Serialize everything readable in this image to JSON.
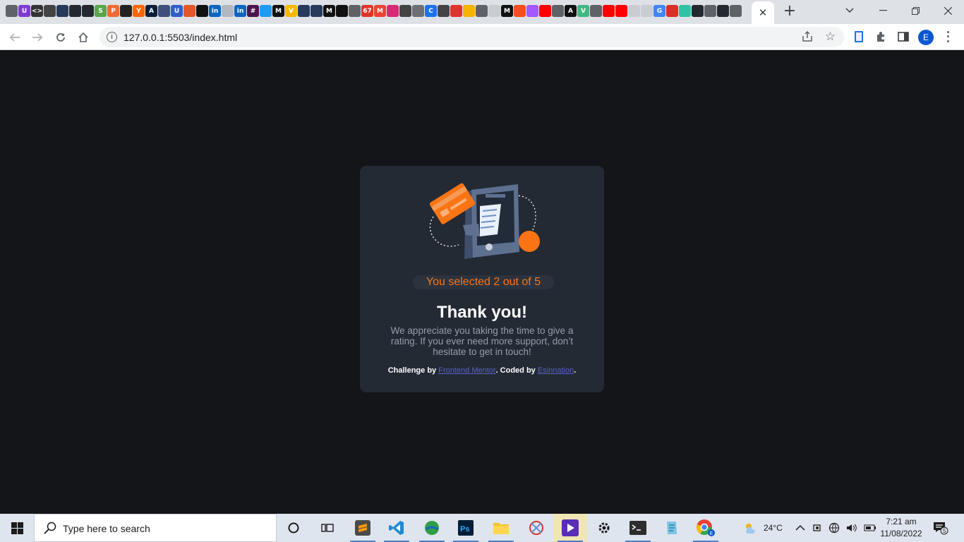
{
  "browser": {
    "active_tab_close": "✕",
    "new_tab": "+",
    "url": "127.0.0.1:5503/index.html",
    "profile_initial": "E",
    "favicons": [
      {
        "name": "chrome-favicon",
        "glyph": "",
        "color": "#5f6368"
      },
      {
        "name": "u-favicon",
        "glyph": "U",
        "color": "#7e3bd1"
      },
      {
        "name": "code-favicon",
        "glyph": "<>",
        "color": "#333333"
      },
      {
        "name": "window-favicon",
        "glyph": "",
        "color": "#444444"
      },
      {
        "name": "grid-favicon",
        "glyph": "",
        "color": "#263a5a"
      },
      {
        "name": "github-favicon",
        "glyph": "",
        "color": "#24292f"
      },
      {
        "name": "github-favicon-2",
        "glyph": "",
        "color": "#24292f"
      },
      {
        "name": "s-favicon",
        "glyph": "S",
        "color": "#5aa64b"
      },
      {
        "name": "p-favicon",
        "glyph": "P",
        "color": "#f06a35"
      },
      {
        "name": "terminal-favicon",
        "glyph": "",
        "color": "#222222"
      },
      {
        "name": "y-favicon",
        "glyph": "Y",
        "color": "#ff6600"
      },
      {
        "name": "a-favicon",
        "glyph": "A",
        "color": "#0b1f3a"
      },
      {
        "name": "book-favicon",
        "glyph": "",
        "color": "#3d4f7a"
      },
      {
        "name": "u-favicon-2",
        "glyph": "U",
        "color": "#2f5fc9"
      },
      {
        "name": "gem-favicon",
        "glyph": "",
        "color": "#e3572a"
      },
      {
        "name": "box-favicon",
        "glyph": "",
        "color": "#111111"
      },
      {
        "name": "linkedin-favicon",
        "glyph": "in",
        "color": "#0a66c2"
      },
      {
        "name": "dev-favicon",
        "glyph": "",
        "color": "#b0b8c4"
      },
      {
        "name": "linkedin-favicon-2",
        "glyph": "in",
        "color": "#0a66c2"
      },
      {
        "name": "slack-favicon",
        "glyph": "#",
        "color": "#4a154b"
      },
      {
        "name": "twitter-favicon",
        "glyph": "",
        "color": "#1d9bf0"
      },
      {
        "name": "medium-favicon",
        "glyph": "M",
        "color": "#111111"
      },
      {
        "name": "v-favicon",
        "glyph": "V",
        "color": "#f5b900"
      },
      {
        "name": "react-favicon",
        "glyph": "",
        "color": "#263a5a"
      },
      {
        "name": "react-favicon-2",
        "glyph": "",
        "color": "#263a5a"
      },
      {
        "name": "medium-favicon-2",
        "glyph": "M",
        "color": "#111111"
      },
      {
        "name": "bolt-favicon",
        "glyph": "",
        "color": "#111111"
      },
      {
        "name": "chrome-favicon-2",
        "glyph": "",
        "color": "#5f6368"
      },
      {
        "name": "counter-favicon",
        "glyph": "67",
        "color": "#e0332a"
      },
      {
        "name": "gmail-favicon",
        "glyph": "M",
        "color": "#ea4335"
      },
      {
        "name": "instagram-favicon",
        "glyph": "",
        "color": "#d62976"
      },
      {
        "name": "doc-favicon",
        "glyph": "",
        "color": "#444444"
      },
      {
        "name": "discord-favicon",
        "glyph": "",
        "color": "#6b6f76"
      },
      {
        "name": "c-favicon",
        "glyph": "C",
        "color": "#1a73e8"
      },
      {
        "name": "window-favicon-2",
        "glyph": "",
        "color": "#444444"
      },
      {
        "name": "pen-favicon",
        "glyph": "",
        "color": "#e0332a"
      },
      {
        "name": "swatch-favicon",
        "glyph": "",
        "color": "#f4b400"
      },
      {
        "name": "chrome-favicon-3",
        "glyph": "",
        "color": "#5f6368"
      },
      {
        "name": "dash-favicon",
        "glyph": "",
        "color": "#c9ccd1"
      },
      {
        "name": "medium-favicon-3",
        "glyph": "M",
        "color": "#111111"
      },
      {
        "name": "figma-favicon",
        "glyph": "",
        "color": "#f24e1e"
      },
      {
        "name": "figma-favicon-2",
        "glyph": "",
        "color": "#a259ff"
      },
      {
        "name": "youtube-favicon",
        "glyph": "",
        "color": "#ff0000"
      },
      {
        "name": "chrome-favicon-4",
        "glyph": "",
        "color": "#5f6368"
      },
      {
        "name": "a-favicon-2",
        "glyph": "A",
        "color": "#111111"
      },
      {
        "name": "vue-favicon",
        "glyph": "V",
        "color": "#41b883"
      },
      {
        "name": "chrome-favicon-5",
        "glyph": "",
        "color": "#5f6368"
      },
      {
        "name": "youtube-favicon-2",
        "glyph": "",
        "color": "#ff0000"
      },
      {
        "name": "youtube-favicon-3",
        "glyph": "",
        "color": "#ff0000"
      },
      {
        "name": "dash-favicon-2",
        "glyph": "",
        "color": "#c9ccd1"
      },
      {
        "name": "dash-favicon-3",
        "glyph": "",
        "color": "#c9ccd1"
      },
      {
        "name": "google-favicon",
        "glyph": "G",
        "color": "#4285f4"
      },
      {
        "name": "bookmark-favicon",
        "glyph": "",
        "color": "#d93025"
      },
      {
        "name": "cube-favicon",
        "glyph": "",
        "color": "#30c2a6"
      },
      {
        "name": "github-favicon-3",
        "glyph": "",
        "color": "#24292f"
      },
      {
        "name": "chrome-favicon-6",
        "glyph": "",
        "color": "#5f6368"
      },
      {
        "name": "github-favicon-4",
        "glyph": "",
        "color": "#24292f"
      },
      {
        "name": "chrome-favicon-7",
        "glyph": "",
        "color": "#5f6368"
      }
    ]
  },
  "card": {
    "pill": "You selected 2 out of 5",
    "title": "Thank you!",
    "body": "We appreciate you taking the time to give a rating. If you ever need more support, don’t hesitate to get in touch!",
    "attribution": {
      "challenge_by": "Challenge by",
      "challenge_link": "Frontend Mentor",
      "coded_by": ". Coded by",
      "coder_link": "Esinnation",
      "end": "."
    },
    "accent": "#fb7413"
  },
  "taskbar": {
    "search_placeholder": "Type here to search",
    "weather": "24°C",
    "time": "7:21 am",
    "date": "11/08/2022",
    "notification_count": "5"
  }
}
